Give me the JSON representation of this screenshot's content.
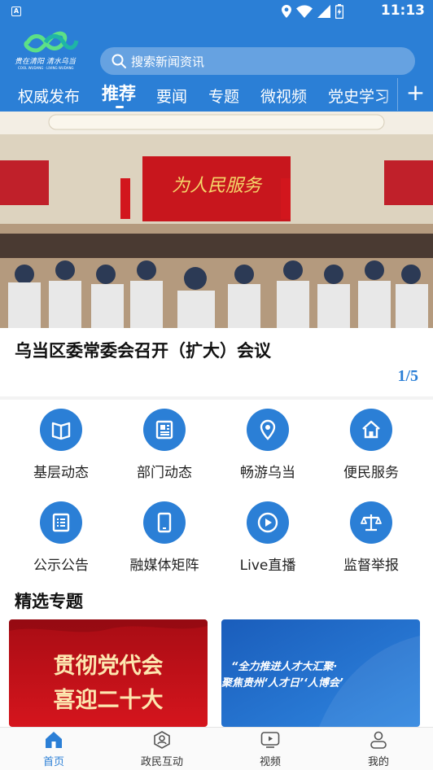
{
  "status_bar": {
    "time": "11:13",
    "app_badge": "A"
  },
  "header": {
    "logo_text": "贵在清阳 清水乌当",
    "search": {
      "placeholder": "搜索新闻资讯"
    }
  },
  "tabs": [
    {
      "label": "权威发布"
    },
    {
      "label": "推荐",
      "active": true
    },
    {
      "label": "要闻"
    },
    {
      "label": "专题"
    },
    {
      "label": "微视频"
    },
    {
      "label": "党史学习"
    }
  ],
  "hero": {
    "title": "乌当区委常委会召开（扩大）会议",
    "pager": "1/5",
    "banner_text": "为人民服务"
  },
  "grid": [
    {
      "label": "基层动态",
      "icon": "book-icon"
    },
    {
      "label": "部门动态",
      "icon": "newspaper-icon"
    },
    {
      "label": "畅游乌当",
      "icon": "location-pin-icon"
    },
    {
      "label": "便民服务",
      "icon": "home-icon"
    },
    {
      "label": "公示公告",
      "icon": "list-document-icon"
    },
    {
      "label": "融媒体矩阵",
      "icon": "tablet-icon"
    },
    {
      "label": "Live直播",
      "icon": "play-circle-icon"
    },
    {
      "label": "监督举报",
      "icon": "scale-icon"
    }
  ],
  "featured": {
    "title": "精选专题",
    "cards": [
      {
        "line1": "贯彻党代会",
        "line2": "喜迎二十大"
      },
      {
        "line1": "“全力推进人才大汇聚·",
        "line2": "聚焦贵州‘人才日’‘人博会’"
      }
    ]
  },
  "bottom_nav": [
    {
      "label": "首页",
      "icon": "home-icon",
      "active": true
    },
    {
      "label": "政民互动",
      "icon": "interaction-icon"
    },
    {
      "label": "视频",
      "icon": "video-icon"
    },
    {
      "label": "我的",
      "icon": "user-icon"
    }
  ],
  "colors": {
    "brand": "#2b7fd6",
    "banner_red": "#c8161d"
  }
}
